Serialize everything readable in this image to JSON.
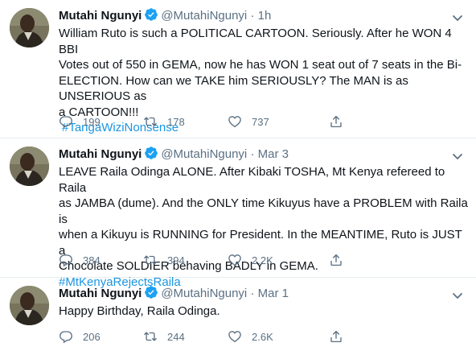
{
  "tweets": [
    {
      "name": "Mutahi Ngunyi",
      "handle": "@MutahiNgunyi",
      "time": "· 1h",
      "lines": [
        "William Ruto is such a POLITICAL CARTOON. Seriously. After he WON 4 BBI",
        "Votes out of 550 in GEMA, now he has WON 1 seat out of 7 seats in the Bi-",
        "ELECTION. How can we TAKE him SERIOUSLY? The MAN is as UNSERIOUS as",
        "a CARTOON!!!"
      ],
      "hashtag": "#TangaWiziNonsense",
      "replies": "199",
      "retweets": "178",
      "likes": "737"
    },
    {
      "name": "Mutahi Ngunyi",
      "handle": "@MutahiNgunyi",
      "time": "· Mar 3",
      "lines": [
        "LEAVE Raila Odinga ALONE. After Kibaki TOSHA, Mt Kenya refereed to Raila",
        "as JAMBA (dume). And the ONLY time Kikuyus have a PROBLEM with Raila is",
        "when a Kikuyu is RUNNING for President. In the MEANTIME, Ruto is JUST a",
        "Chocolate SOLDIER behaving BADLY in GEMA."
      ],
      "hashtag": "#MtKenyaRejectsRaila",
      "replies": "384",
      "retweets": "394",
      "likes": "2.2K"
    },
    {
      "name": "Mutahi Ngunyi",
      "handle": "@MutahiNgunyi",
      "time": "· Mar 1",
      "lines": [
        "Happy Birthday, Raila Odinga."
      ],
      "hashtag": "",
      "replies": "206",
      "retweets": "244",
      "likes": "2.6K"
    }
  ],
  "icons": {
    "verified": "verified-badge-icon",
    "more": "chevron-down-icon",
    "reply": "reply-icon",
    "retweet": "retweet-icon",
    "like": "heart-icon",
    "share": "share-icon"
  },
  "colors": {
    "accent": "#1b95e0",
    "muted": "#5b7083",
    "divider": "#e6ecf0",
    "verified": "#1da1f2"
  }
}
